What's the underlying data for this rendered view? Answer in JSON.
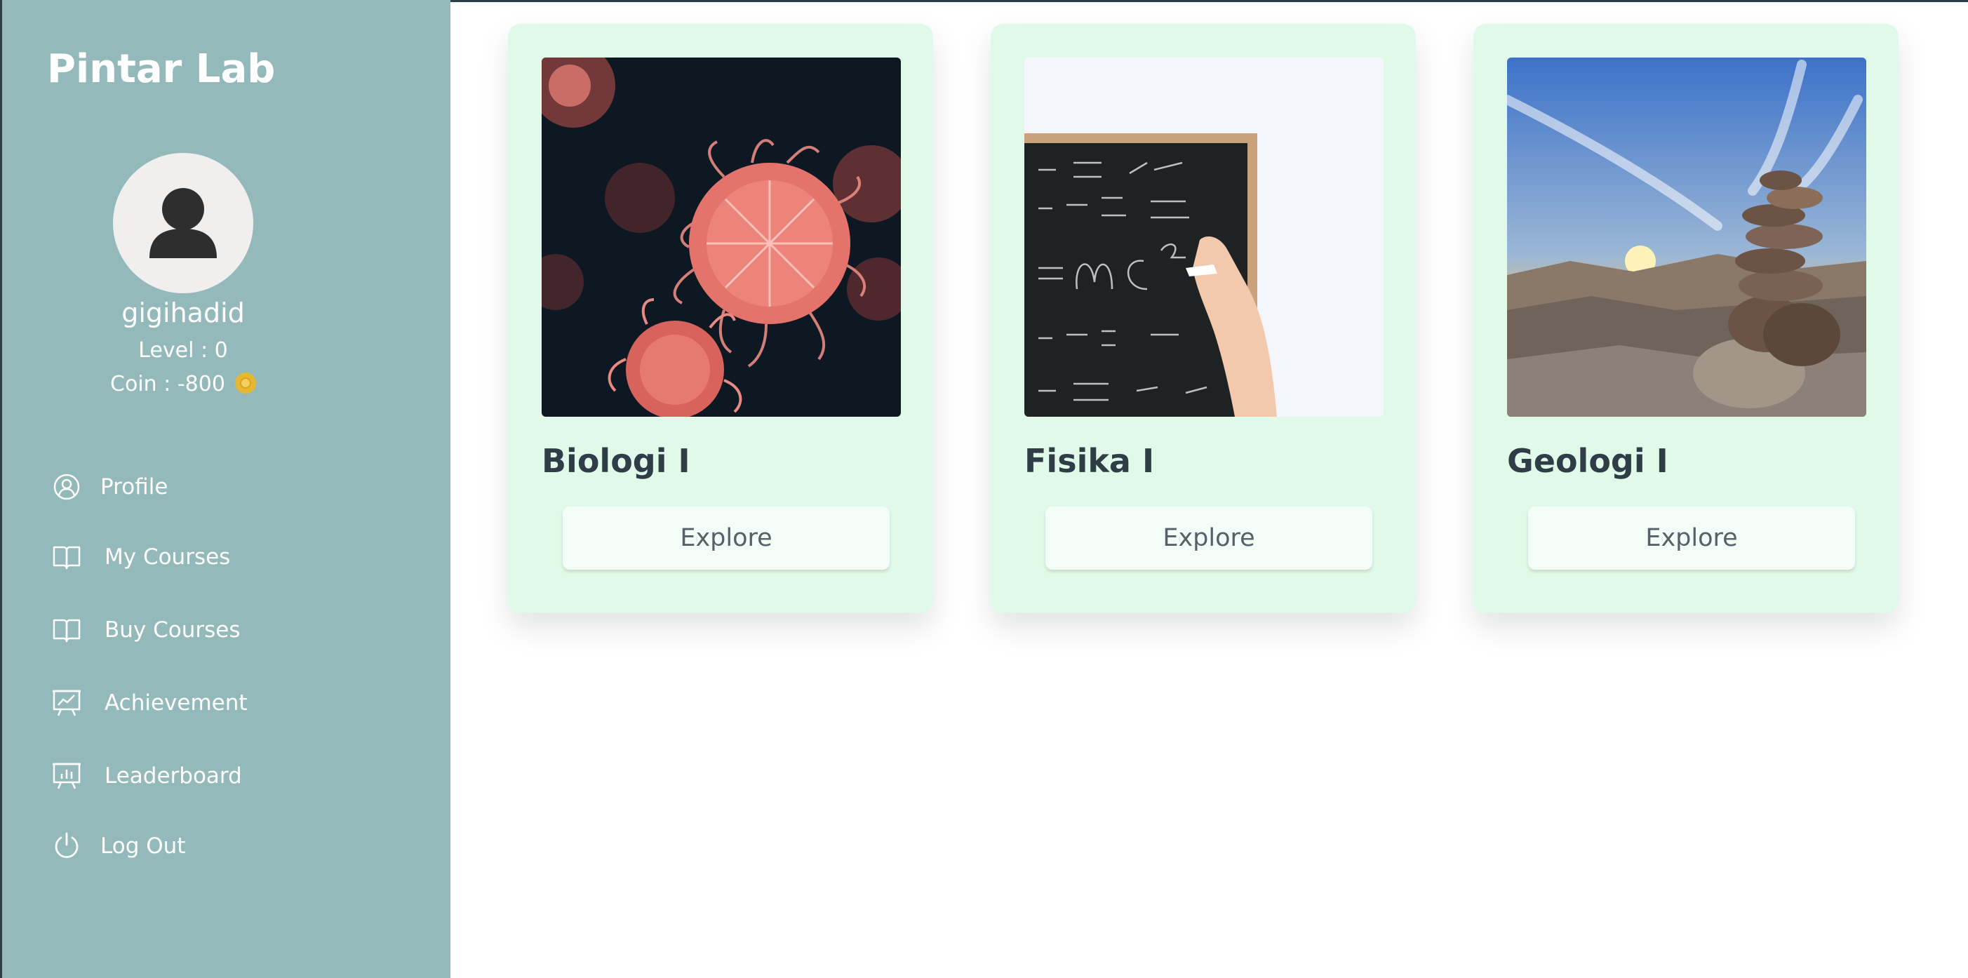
{
  "app": {
    "brand": "Pintar Lab"
  },
  "user": {
    "username": "gigihadid",
    "level_text": "Level : 0",
    "coin_text": "Coin : -800"
  },
  "sidebar": {
    "items": [
      {
        "label": "Profile",
        "icon": "user-circle-icon"
      },
      {
        "label": "My Courses",
        "icon": "book-open-icon"
      },
      {
        "label": "Buy Courses",
        "icon": "book-open-icon"
      },
      {
        "label": "Achievement",
        "icon": "presentation-chart-icon"
      },
      {
        "label": "Leaderboard",
        "icon": "presentation-bars-icon"
      },
      {
        "label": "Log Out",
        "icon": "power-icon"
      }
    ]
  },
  "courses": [
    {
      "title": "Biologi I",
      "button": "Explore",
      "image": "jellyfish-photo"
    },
    {
      "title": "Fisika I",
      "button": "Explore",
      "image": "chalkboard-formula-photo"
    },
    {
      "title": "Geologi I",
      "button": "Explore",
      "image": "rock-cairn-sunset-photo"
    }
  ],
  "colors": {
    "sidebar_bg": "#93b9bb",
    "card_bg": "#e1f9e8",
    "title_text": "#2f3e46",
    "coin": "#e7b731"
  }
}
